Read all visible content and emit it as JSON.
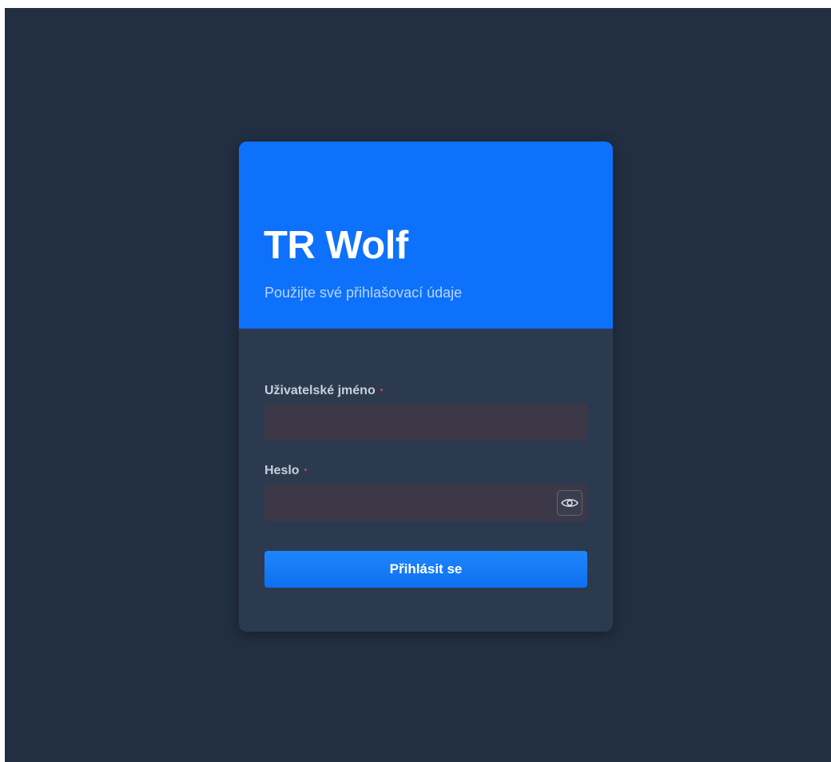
{
  "login": {
    "title": "TR Wolf",
    "subtitle": "Použijte své přihlašovací údaje",
    "username": {
      "label": "Uživatelské jméno",
      "required_mark": "•",
      "value": "",
      "placeholder": ""
    },
    "password": {
      "label": "Heslo",
      "required_mark": "•",
      "value": "",
      "placeholder": "",
      "toggle_icon": "eye-icon"
    },
    "submit_label": "Přihlásit se"
  },
  "colors": {
    "page_background": "#222f42",
    "card_body": "#2c3a50",
    "header_accent": "#0d71fb",
    "input_background": "#3d3848",
    "required": "#e0434f"
  }
}
